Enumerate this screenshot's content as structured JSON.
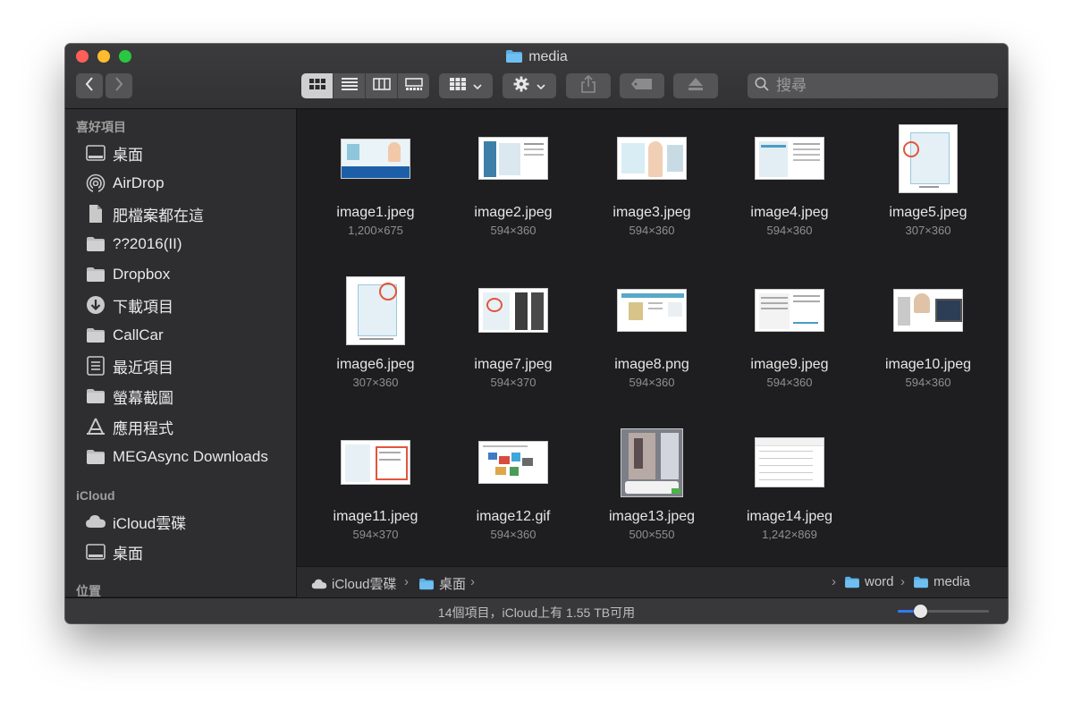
{
  "window": {
    "title": "media",
    "accent_color": "#2f7bf5"
  },
  "toolbar": {
    "back_icon": "chevron-left-icon",
    "forward_icon": "chevron-right-icon",
    "view_modes": [
      "icon-view",
      "list-view",
      "column-view",
      "gallery-view"
    ],
    "active_view": "icon-view",
    "search": {
      "placeholder": "搜尋",
      "value": ""
    }
  },
  "sidebar": {
    "favorites_header": "喜好項目",
    "favorites": [
      {
        "label": "桌面",
        "icon": "desktop-icon"
      },
      {
        "label": "AirDrop",
        "icon": "airdrop-icon"
      },
      {
        "label": "肥檔案都在這",
        "icon": "document-icon"
      },
      {
        "label": "??2016(II)",
        "icon": "folder-icon"
      },
      {
        "label": "Dropbox",
        "icon": "folder-icon"
      },
      {
        "label": "下載項目",
        "icon": "download-icon"
      },
      {
        "label": "CallCar",
        "icon": "folder-icon"
      },
      {
        "label": "最近項目",
        "icon": "recents-icon"
      },
      {
        "label": "螢幕截圖",
        "icon": "folder-icon"
      },
      {
        "label": "應用程式",
        "icon": "applications-icon"
      },
      {
        "label": "MEGAsync Downloads",
        "icon": "folder-icon"
      }
    ],
    "icloud_header": "iCloud",
    "icloud": [
      {
        "label": "iCloud雲碟",
        "icon": "cloud-icon"
      },
      {
        "label": "桌面",
        "icon": "desktop-icon"
      }
    ],
    "locations_header": "位置"
  },
  "files": [
    {
      "name": "image1.jpeg",
      "dims": "1,200×675"
    },
    {
      "name": "image2.jpeg",
      "dims": "594×360"
    },
    {
      "name": "image3.jpeg",
      "dims": "594×360"
    },
    {
      "name": "image4.jpeg",
      "dims": "594×360"
    },
    {
      "name": "image5.jpeg",
      "dims": "307×360"
    },
    {
      "name": "image6.jpeg",
      "dims": "307×360"
    },
    {
      "name": "image7.jpeg",
      "dims": "594×370"
    },
    {
      "name": "image8.png",
      "dims": "594×360"
    },
    {
      "name": "image9.jpeg",
      "dims": "594×360"
    },
    {
      "name": "image10.jpeg",
      "dims": "594×360"
    },
    {
      "name": "image11.jpeg",
      "dims": "594×370"
    },
    {
      "name": "image12.gif",
      "dims": "594×360"
    },
    {
      "name": "image13.jpeg",
      "dims": "500×550"
    },
    {
      "name": "image14.jpeg",
      "dims": "1,242×869"
    }
  ],
  "pathbar": {
    "segments": [
      {
        "label": "iCloud雲碟",
        "icon": "cloud-icon"
      },
      {
        "label": "桌面",
        "icon": "folder-icon"
      },
      {
        "label": "word",
        "icon": "folder-icon"
      },
      {
        "label": "media",
        "icon": "folder-icon"
      }
    ]
  },
  "statusbar": {
    "text": "14個項目，iCloud上有 1.55 TB可用",
    "icon_size_level": 0.25
  }
}
